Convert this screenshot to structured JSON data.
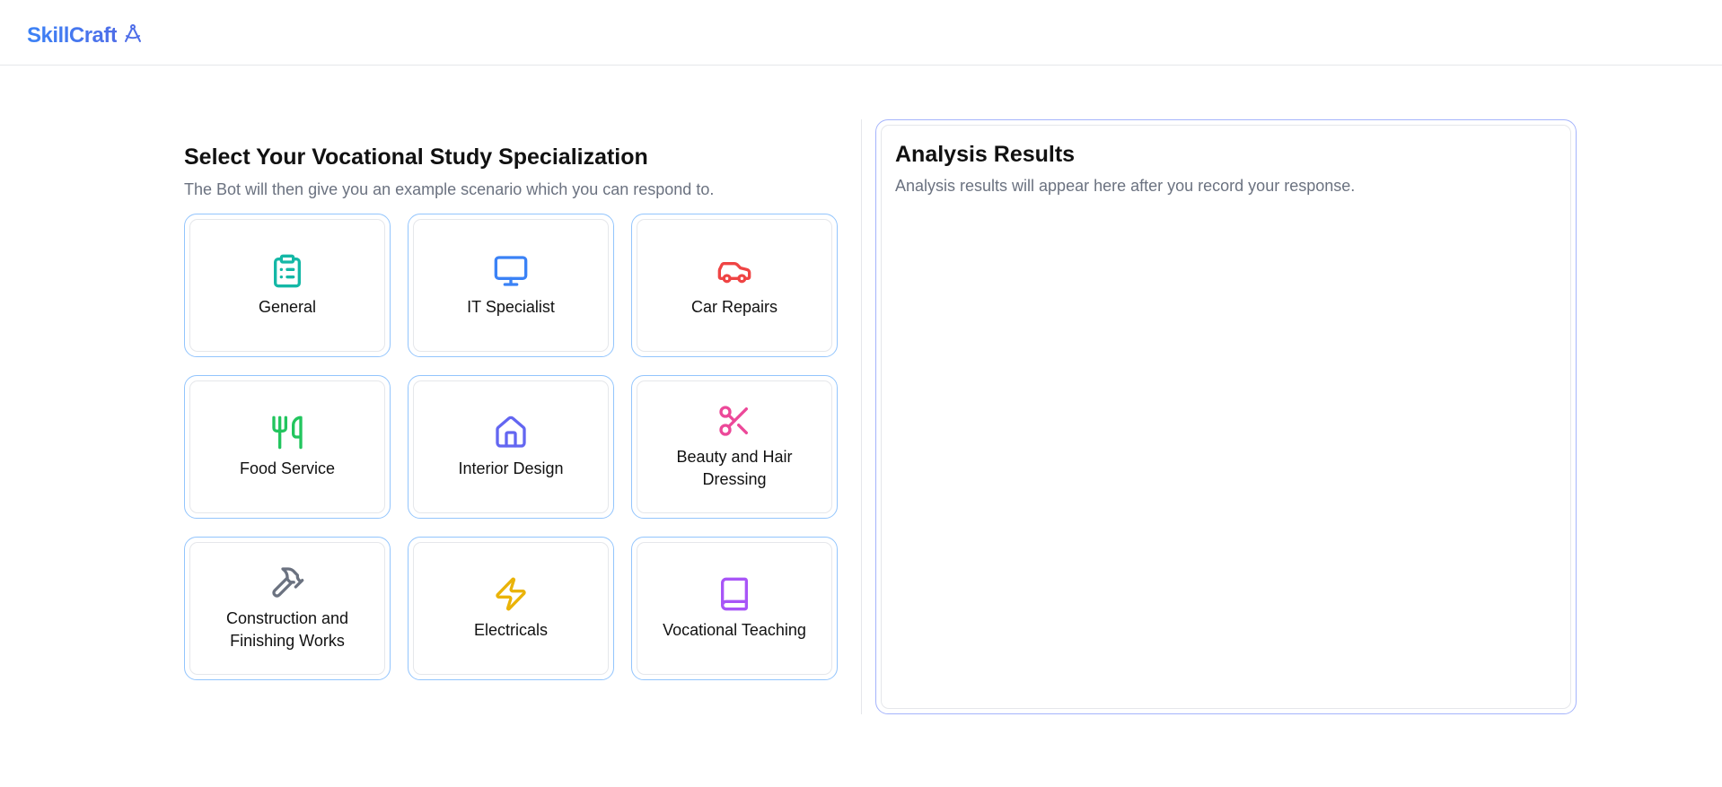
{
  "header": {
    "brand": "SkillCraft",
    "brand_icon": "compass-drafting-icon",
    "brand_color": "#3b82f6"
  },
  "main": {
    "title": "Select Your Vocational Study Specialization",
    "subtitle": "The Bot will then give you an example scenario which you can respond to.",
    "specializations": [
      {
        "label": "General",
        "icon": "clipboard-list-icon",
        "color": "#14b8a6"
      },
      {
        "label": "IT Specialist",
        "icon": "monitor-icon",
        "color": "#3b82f6"
      },
      {
        "label": "Car Repairs",
        "icon": "car-icon",
        "color": "#ef4444"
      },
      {
        "label": "Food Service",
        "icon": "utensils-icon",
        "color": "#22c55e"
      },
      {
        "label": "Interior Design",
        "icon": "home-icon",
        "color": "#6366f1"
      },
      {
        "label": "Beauty and Hair Dressing",
        "icon": "scissors-icon",
        "color": "#ec4899"
      },
      {
        "label": "Construction and Finishing Works",
        "icon": "hammer-icon",
        "color": "#6b7280"
      },
      {
        "label": "Electricals",
        "icon": "zap-icon",
        "color": "#eab308"
      },
      {
        "label": "Vocational Teaching",
        "icon": "book-icon",
        "color": "#a855f7"
      }
    ]
  },
  "results": {
    "title": "Analysis Results",
    "placeholder": "Analysis results will appear here after you record your response."
  }
}
